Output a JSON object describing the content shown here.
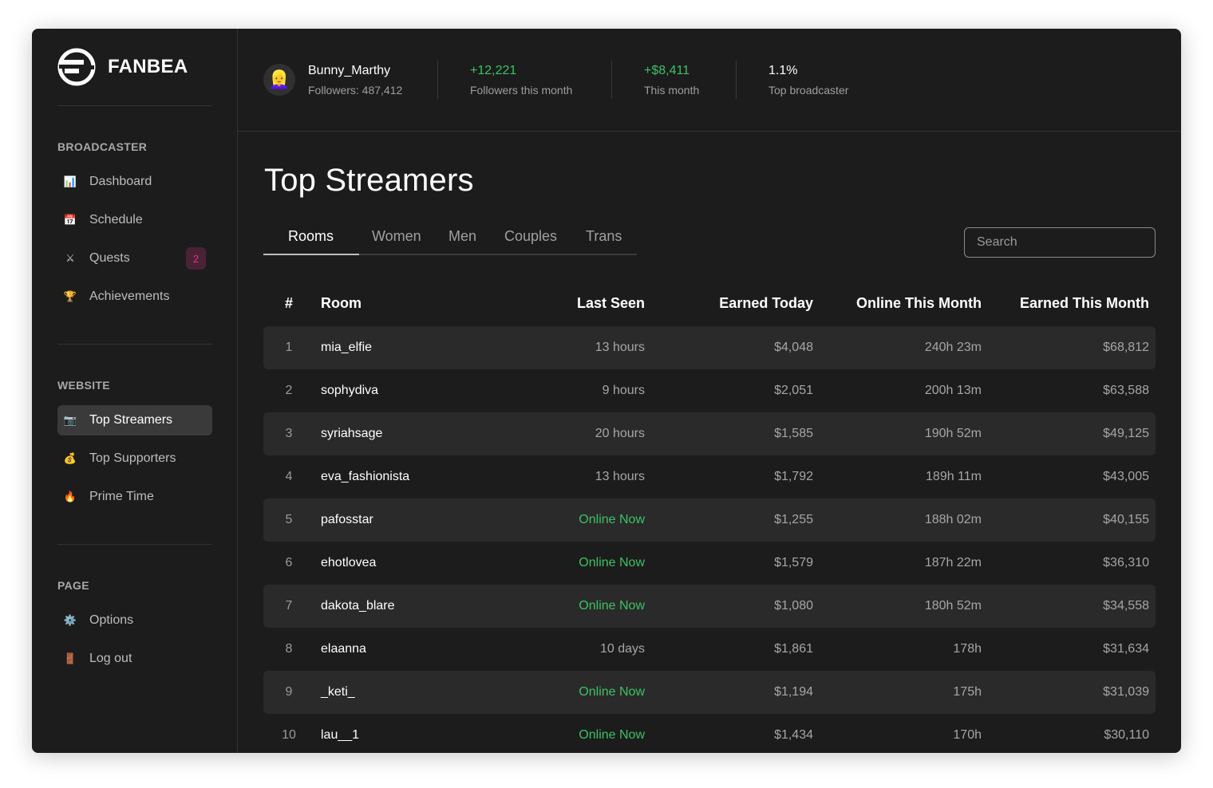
{
  "brand": {
    "name": "FANBEA"
  },
  "sidebar": {
    "sections": [
      {
        "title": "BROADCASTER",
        "items": [
          {
            "label": "Dashboard",
            "icon": "bar-chart-icon"
          },
          {
            "label": "Schedule",
            "icon": "calendar-icon"
          },
          {
            "label": "Quests",
            "icon": "crossed-swords-icon",
            "badge": "2"
          },
          {
            "label": "Achievements",
            "icon": "trophy-icon"
          }
        ]
      },
      {
        "title": "WEBSITE",
        "items": [
          {
            "label": "Top Streamers",
            "icon": "camera-icon",
            "active": true
          },
          {
            "label": "Top Supporters",
            "icon": "money-bag-icon"
          },
          {
            "label": "Prime Time",
            "icon": "fire-icon"
          }
        ]
      },
      {
        "title": "PAGE",
        "items": [
          {
            "label": "Options",
            "icon": "gear-icon"
          },
          {
            "label": "Log out",
            "icon": "door-icon"
          }
        ]
      }
    ]
  },
  "header": {
    "user": {
      "name": "Bunny_Marthy",
      "followers": "Followers: 487,412"
    },
    "stats": [
      {
        "value": "+12,221",
        "label": "Followers this month"
      },
      {
        "value": "+$8,411",
        "label": "This month"
      },
      {
        "value": "1.1%",
        "label": "Top broadcaster"
      }
    ]
  },
  "main": {
    "title": "Top Streamers",
    "tabs": [
      "Rooms",
      "Women",
      "Men",
      "Couples",
      "Trans"
    ],
    "active_tab": "Rooms",
    "search_placeholder": "Search",
    "table": {
      "columns": [
        "#",
        "Room",
        "Last Seen",
        "Earned Today",
        "Online This Month",
        "Earned This Month"
      ],
      "rows": [
        [
          "1",
          "mia_elfie",
          "13 hours",
          "$4,048",
          "240h 23m",
          "$68,812"
        ],
        [
          "2",
          "sophydiva",
          "9 hours",
          "$2,051",
          "200h 13m",
          "$63,588"
        ],
        [
          "3",
          "syriahsage",
          "20 hours",
          "$1,585",
          "190h 52m",
          "$49,125"
        ],
        [
          "4",
          "eva_fashionista",
          "13 hours",
          "$1,792",
          "189h 11m",
          "$43,005"
        ],
        [
          "5",
          "pafosstar",
          "Online Now",
          "$1,255",
          "188h 02m",
          "$40,155"
        ],
        [
          "6",
          "ehotlovea",
          "Online Now",
          "$1,579",
          "187h 22m",
          "$36,310"
        ],
        [
          "7",
          "dakota_blare",
          "Online Now",
          "$1,080",
          "180h 52m",
          "$34,558"
        ],
        [
          "8",
          "elaanna",
          "10 days",
          "$1,861",
          "178h",
          "$31,634"
        ],
        [
          "9",
          "_keti_",
          "Online Now",
          "$1,194",
          "175h",
          "$31,039"
        ],
        [
          "10",
          "lau__1",
          "Online Now",
          "$1,434",
          "170h",
          "$30,110"
        ]
      ]
    }
  },
  "colors": {
    "background": "#1c1c1c",
    "row_alt": "#2a2a2a",
    "accent_green": "#3cc165",
    "badge_pink": "#e0367d"
  }
}
